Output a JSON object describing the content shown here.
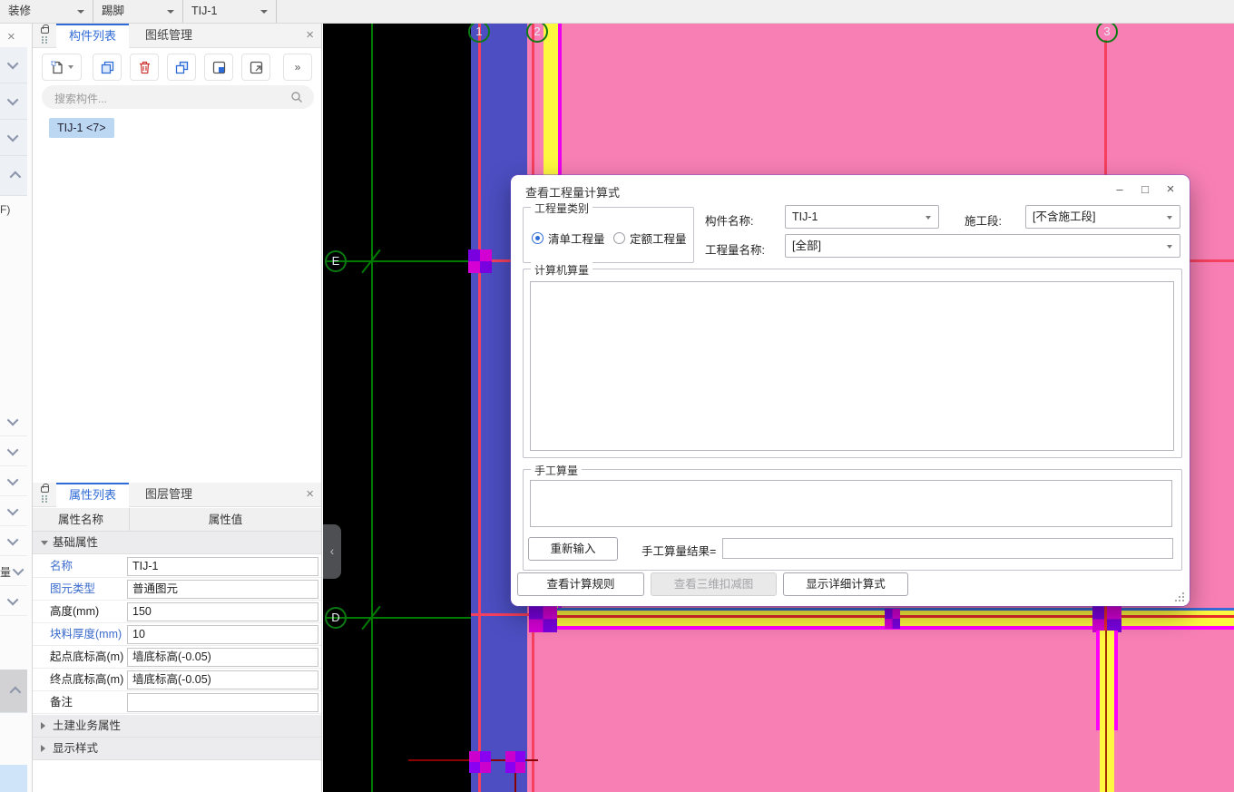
{
  "topbar": {
    "dropdowns": [
      {
        "label": "装修"
      },
      {
        "label": "踢脚"
      },
      {
        "label": "TIJ-1"
      }
    ]
  },
  "left_rail": {
    "close_glyph": "×",
    "partial_labels": [
      "F)",
      "量"
    ]
  },
  "component_panel": {
    "tabs": [
      {
        "label": "构件列表",
        "active": true
      },
      {
        "label": "图纸管理",
        "active": false
      }
    ],
    "close_glyph": "×",
    "toolbar": {
      "more_glyph": "»"
    },
    "search": {
      "placeholder": "搜索构件..."
    },
    "items": [
      {
        "label": "TIJ-1 <7>"
      }
    ]
  },
  "property_panel": {
    "tabs": [
      {
        "label": "属性列表",
        "active": true
      },
      {
        "label": "图层管理",
        "active": false
      }
    ],
    "close_glyph": "×",
    "columns": [
      "属性名称",
      "属性值"
    ],
    "groups": [
      {
        "label": "基础属性",
        "expanded": true
      },
      {
        "label": "土建业务属性",
        "expanded": false
      },
      {
        "label": "显示样式",
        "expanded": false
      }
    ],
    "rows": [
      {
        "name": "名称",
        "value": "TIJ-1",
        "link": true
      },
      {
        "name": "图元类型",
        "value": "普通图元",
        "link": true
      },
      {
        "name": "高度(mm)",
        "value": "150",
        "link": false
      },
      {
        "name": "块料厚度(mm)",
        "value": "10",
        "link": true
      },
      {
        "name": "起点底标高(m)",
        "value": "墙底标高(-0.05)",
        "link": false
      },
      {
        "name": "终点底标高(m)",
        "value": "墙底标高(-0.05)",
        "link": false
      },
      {
        "name": "备注",
        "value": "",
        "link": false
      }
    ]
  },
  "dialog": {
    "title": "查看工程量计算式",
    "window_buttons": {
      "minimize": "–",
      "maximize": "□",
      "close": "×"
    },
    "category_group": {
      "label": "工程量类别",
      "options": [
        {
          "label": "清单工程量",
          "selected": true
        },
        {
          "label": "定额工程量",
          "selected": false
        }
      ]
    },
    "fields": {
      "component_name": {
        "label": "构件名称:",
        "value": "TIJ-1"
      },
      "construction_section": {
        "label": "施工段:",
        "value": "[不含施工段]"
      },
      "quantity_name": {
        "label": "工程量名称:",
        "value": "[全部]"
      }
    },
    "computer_quantity": {
      "label": "计算机算量",
      "content": ""
    },
    "manual_quantity": {
      "label": "手工算量",
      "content": "",
      "reinput_button": "重新输入",
      "result_label": "手工算量结果=",
      "result_value": ""
    },
    "footer_buttons": [
      {
        "label": "查看计算规则",
        "enabled": true
      },
      {
        "label": "查看三维扣减图",
        "enabled": false
      },
      {
        "label": "显示详细计算式",
        "enabled": true
      }
    ]
  },
  "canvas": {
    "collapse_glyph": "‹",
    "axis_bubbles": [
      {
        "label": "1"
      },
      {
        "label": "2"
      },
      {
        "label": "3"
      },
      {
        "label": "E"
      },
      {
        "label": "D"
      }
    ],
    "colors": {
      "background": "#000000",
      "pink_fill": "#F77FB4",
      "blue_wall": "#4C4EC2",
      "yellow_wall": "#FFF840",
      "magenta_line": "#EE00EE",
      "red_axis": "#F5405F",
      "green_grid": "#007B00",
      "band_blue": "#3A6AD4",
      "junction_purple": "#7A00E0",
      "dark_red": "#8B0000"
    }
  }
}
